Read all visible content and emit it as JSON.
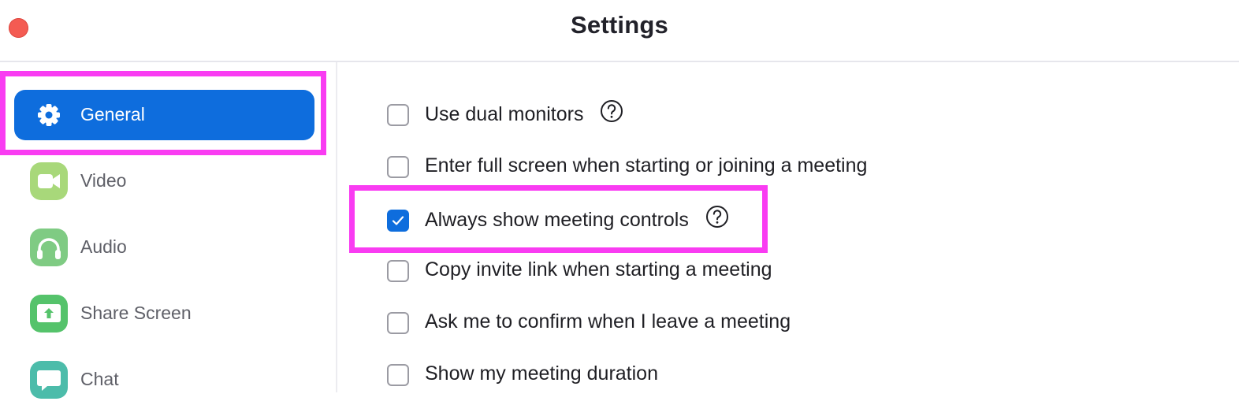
{
  "window": {
    "title": "Settings"
  },
  "sidebar": {
    "items": [
      {
        "label": "General",
        "icon": "gear-icon",
        "active": true
      },
      {
        "label": "Video",
        "icon": "video-camera-icon",
        "active": false
      },
      {
        "label": "Audio",
        "icon": "headphones-icon",
        "active": false
      },
      {
        "label": "Share Screen",
        "icon": "share-screen-icon",
        "active": false
      },
      {
        "label": "Chat",
        "icon": "chat-bubble-icon",
        "active": false
      }
    ]
  },
  "general": {
    "options": [
      {
        "label": "Use dual monitors",
        "checked": false,
        "help": true
      },
      {
        "label": "Enter full screen when starting or joining a meeting",
        "checked": false,
        "help": false
      },
      {
        "label": "Always show meeting controls",
        "checked": true,
        "help": true
      },
      {
        "label": "Copy invite link when starting a meeting",
        "checked": false,
        "help": false
      },
      {
        "label": "Ask me to confirm when I leave a meeting",
        "checked": false,
        "help": false
      },
      {
        "label": "Show my meeting duration",
        "checked": false,
        "help": false
      }
    ]
  },
  "colors": {
    "accent": "#0e6ddd",
    "highlight": "#f93cf2",
    "close_button": "#f45b52",
    "video_icon_bg": "#a8d87a",
    "audio_icon_bg": "#7fcb83",
    "share_icon_bg": "#55c36b",
    "chat_icon_bg": "#4cbcaa"
  }
}
